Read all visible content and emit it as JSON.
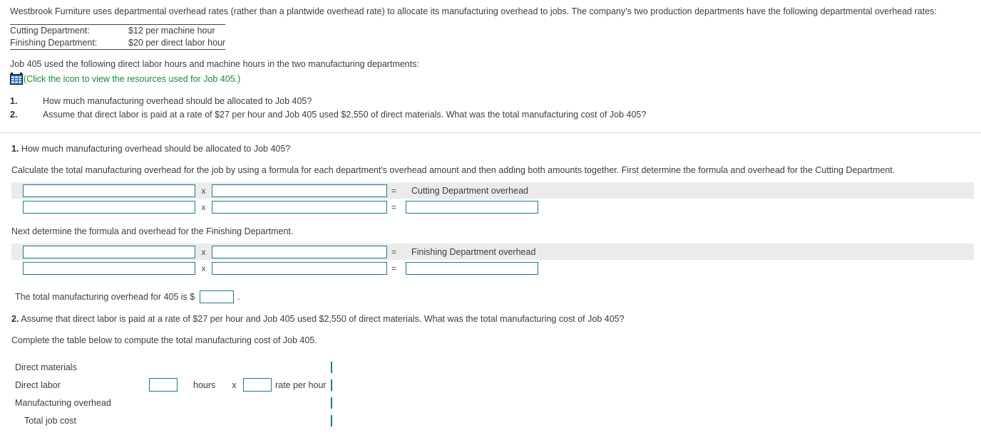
{
  "problem": {
    "intro": "Westbrook Furniture uses departmental overhead rates (rather than a plantwide overhead rate) to allocate its manufacturing overhead to jobs. The company's two production departments have the following departmental overhead rates:",
    "rates": [
      {
        "department": "Cutting Department:",
        "rate": "$12 per machine hour"
      },
      {
        "department": "Finishing Department:",
        "rate": "$20 per direct labor hour"
      }
    ],
    "job_line": "Job 405 used the following direct labor hours and machine hours in the two manufacturing departments:",
    "icon": {
      "name": "spreadsheet-icon",
      "caption": "(Click the icon to view the resources used for Job 405.)"
    },
    "requirements": [
      {
        "num": "1.",
        "text": "How much manufacturing overhead should be allocated to Job 405?"
      },
      {
        "num": "2.",
        "text": "Assume that direct labor is paid at a rate of $27 per hour and Job 405 used $2,550 of direct materials. What was the total manufacturing cost of Job 405?"
      }
    ]
  },
  "answer": {
    "q1": {
      "number": "1.",
      "question": "How much manufacturing overhead should be allocated to Job 405?",
      "instruction": "Calculate the total manufacturing overhead for the job by using a formula for each department's overhead amount and then adding both amounts together. First determine the formula and overhead for the Cutting Department.",
      "cutting": {
        "header_row": {
          "op1": "x",
          "op2": "=",
          "label": "Cutting Department overhead"
        },
        "value_row": {
          "op1": "x",
          "op2": "="
        },
        "input_factor1": "",
        "input_factor2": "",
        "input_result": ""
      },
      "finishing_instruction": "Next determine the formula and overhead for the Finishing Department.",
      "finishing": {
        "header_row": {
          "op1": "x",
          "op2": "=",
          "label": "Finishing Department overhead"
        },
        "value_row": {
          "op1": "x",
          "op2": "="
        },
        "input_factor1": "",
        "input_factor2": "",
        "input_result": ""
      },
      "total_prefix": "The total manufacturing overhead for 405 is $",
      "total_value": "",
      "total_suffix": "."
    },
    "q2": {
      "number": "2.",
      "question": "Assume that direct labor is paid at a rate of $27 per hour and Job 405 used $2,550 of direct materials. What was the total manufacturing cost of Job 405?",
      "instruction": "Complete the table below to compute the total manufacturing cost of Job 405.",
      "rows": [
        {
          "label": "Direct materials",
          "hours": "",
          "hours_label": "",
          "op": "",
          "rate": "",
          "rate_label": "",
          "amount": "",
          "underline": "none"
        },
        {
          "label": "Direct labor",
          "hours": "",
          "hours_label": "hours",
          "op": "x",
          "rate": "",
          "rate_label": "rate per hour",
          "amount": "",
          "underline": "none"
        },
        {
          "label": "Manufacturing overhead",
          "hours": "",
          "hours_label": "",
          "op": "",
          "rate": "",
          "rate_label": "",
          "amount": "",
          "underline": "single"
        },
        {
          "label": "Total job cost",
          "hours": "",
          "hours_label": "",
          "op": "",
          "rate": "",
          "rate_label": "",
          "amount": "",
          "underline": "double"
        }
      ]
    }
  },
  "colors": {
    "input_border": "#1a7a96",
    "shaded_row": "#ebebeb",
    "link_green": "#1a8a3c",
    "text": "#3d3d3d"
  }
}
